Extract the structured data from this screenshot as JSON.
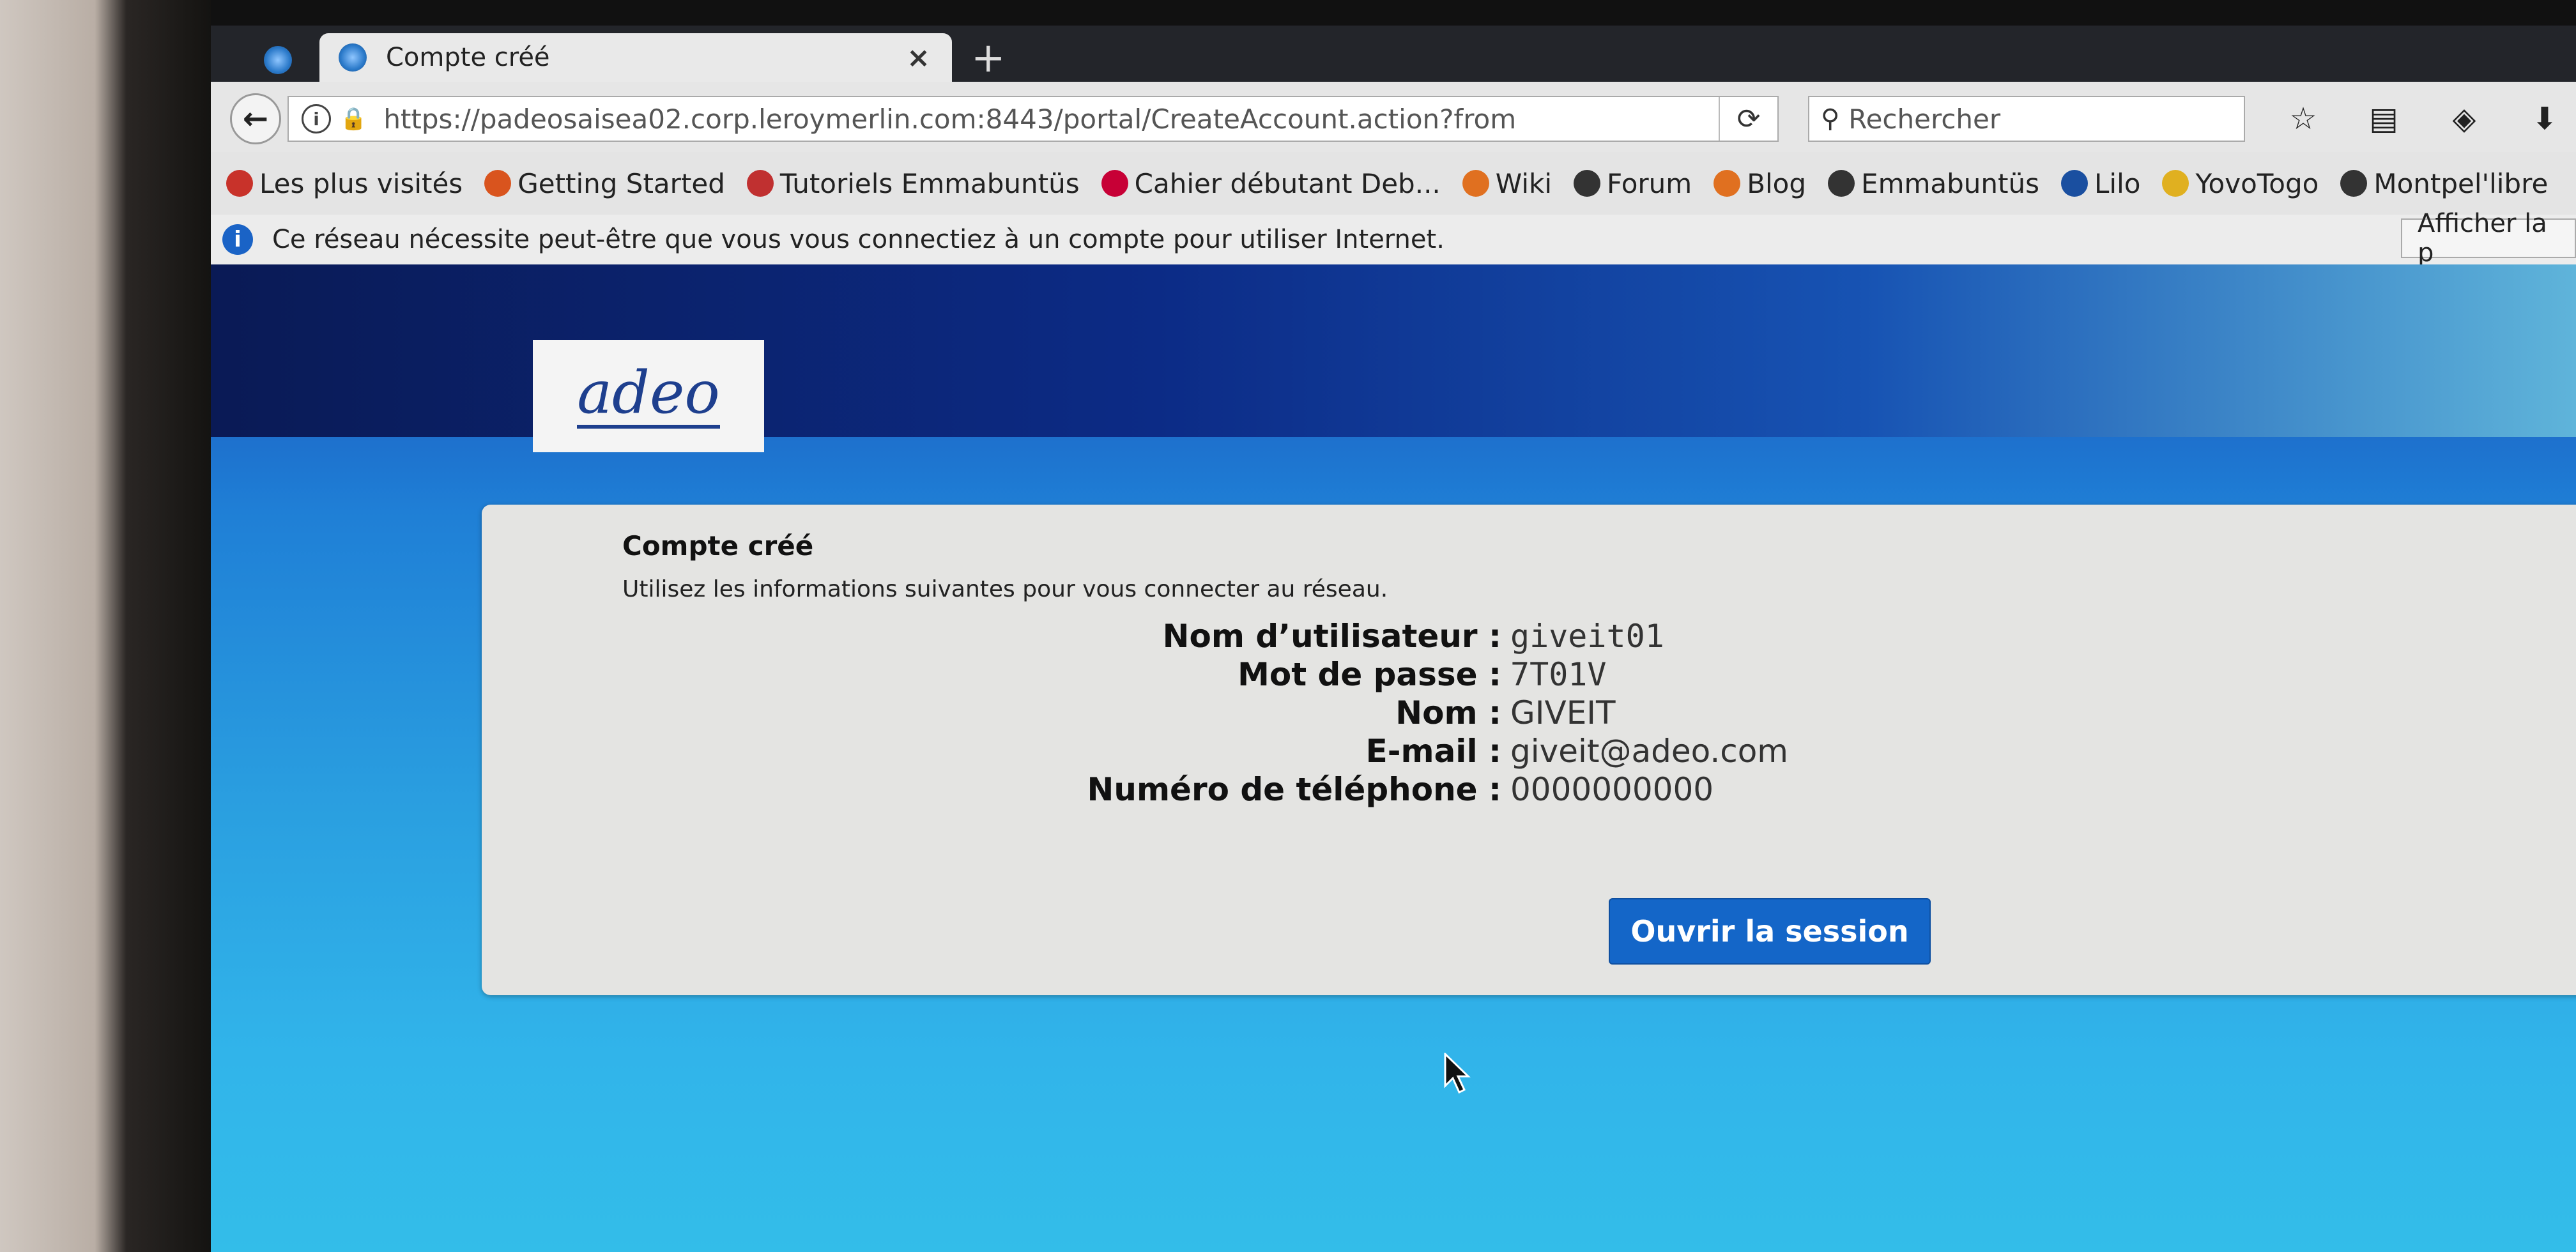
{
  "browser": {
    "tab_title": "Compte créé",
    "new_tab_symbol": "+",
    "close_symbol": "×",
    "url": "https://padeosaisea02.corp.leroymerlin.com:8443/portal/CreateAccount.action?from",
    "search_placeholder": "Rechercher",
    "bookmarks": [
      {
        "label": "Les plus visités",
        "icon": "most-visited-icon",
        "color": "#c8322a"
      },
      {
        "label": "Getting Started",
        "icon": "firefox-icon",
        "color": "#d9541e"
      },
      {
        "label": "Tutoriels Emmabuntüs",
        "icon": "emmabuntus-icon",
        "color": "#c03030"
      },
      {
        "label": "Cahier débutant Deb...",
        "icon": "debian-icon",
        "color": "#c70036"
      },
      {
        "label": "Wiki",
        "icon": "wiki-icon",
        "color": "#e07020"
      },
      {
        "label": "Forum",
        "icon": "globe-icon",
        "color": "#333333"
      },
      {
        "label": "Blog",
        "icon": "blog-icon",
        "color": "#e07020"
      },
      {
        "label": "Emmabuntüs",
        "icon": "wikipedia-icon",
        "color": "#333333"
      },
      {
        "label": "Lilo",
        "icon": "lilo-icon",
        "color": "#1a4fa0"
      },
      {
        "label": "YovoTogo",
        "icon": "yovotogo-icon",
        "color": "#e0b020"
      },
      {
        "label": "Montpel'libre",
        "icon": "globe-icon",
        "color": "#333333"
      }
    ],
    "notification": {
      "text": "Ce réseau nécessite peut-être que vous vous connectiez à un compte pour utiliser Internet.",
      "button": "Afficher la p"
    }
  },
  "page": {
    "logo_text": "adeo",
    "card": {
      "title": "Compte créé",
      "subtitle": "Utilisez les informations suivantes pour vous connecter au réseau.",
      "fields": [
        {
          "label": "Nom d’utilisateur :",
          "value": "giveit01"
        },
        {
          "label": "Mot de passe :",
          "value": "7T01V"
        },
        {
          "label": "Nom :",
          "value": "GIVEIT"
        },
        {
          "label": "E-mail :",
          "value": "giveit@adeo.com"
        },
        {
          "label": "Numéro de téléphone :",
          "value": "0000000000"
        }
      ],
      "submit_label": "Ouvrir la session"
    }
  }
}
